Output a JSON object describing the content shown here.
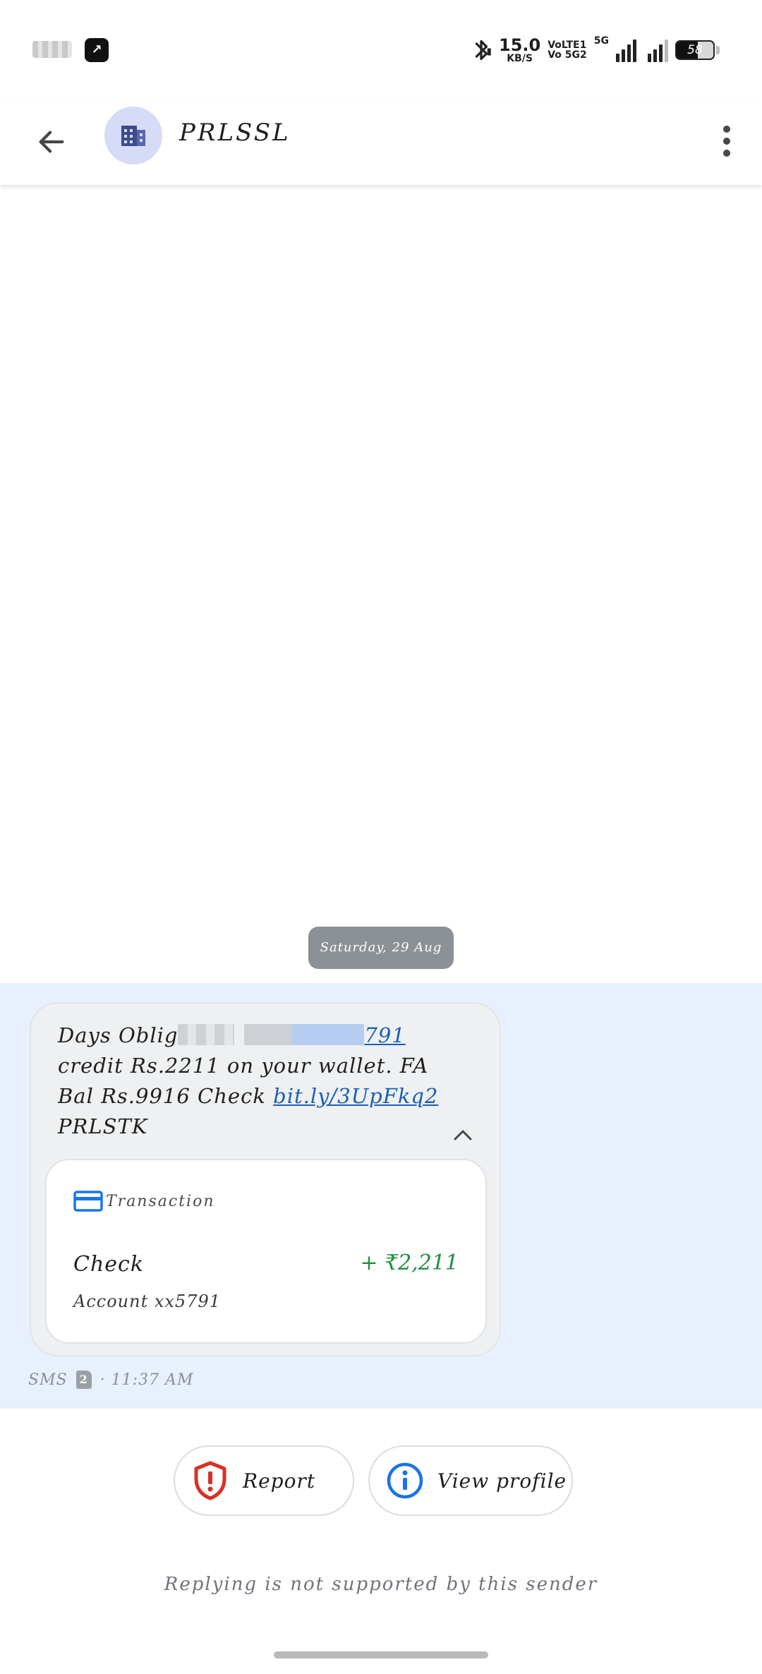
{
  "status_bar": {
    "speed_value": "15.0",
    "speed_unit": "KB/S",
    "volte_1": "VoLTE1",
    "volte_2": "Vo 5G2",
    "network": "5G",
    "battery_level": "58",
    "battery_fraction": 0.58
  },
  "header": {
    "title": "PRLSSL",
    "back_icon": "arrow-left-icon",
    "avatar_icon": "business-building-icon",
    "menu_icon": "more-vertical-icon"
  },
  "conversation": {
    "date_label": "Saturday, 29 Aug",
    "message": {
      "line1_start": "Days Oblig",
      "line1_link_end": "791",
      "line2": "credit Rs.2211 on your wallet. FA",
      "line3_start": "Bal Rs.9916 Check ",
      "line3_link": "bit.ly/3UpFkq2",
      "line4": "PRLSTK"
    },
    "transaction_card": {
      "label": "Transaction",
      "icon": "credit-card-icon",
      "name": "Check",
      "amount": "+ ₹2,211",
      "account": "Account xx5791"
    },
    "meta": {
      "channel": "SMS",
      "sim": "2",
      "time": "· 11:37 AM"
    }
  },
  "actions": {
    "report_label": "Report",
    "view_profile_label": "View profile"
  },
  "footer_note": "Replying is not supported by this sender",
  "colors": {
    "highlight_bg": "#e8f0fd",
    "link": "#1a5fb4",
    "amount_green": "#1e8e3e",
    "report_red": "#d93025",
    "info_blue": "#1a73e8",
    "avatar_bg": "#d6dcf7",
    "avatar_fg": "#3f4b8c"
  }
}
